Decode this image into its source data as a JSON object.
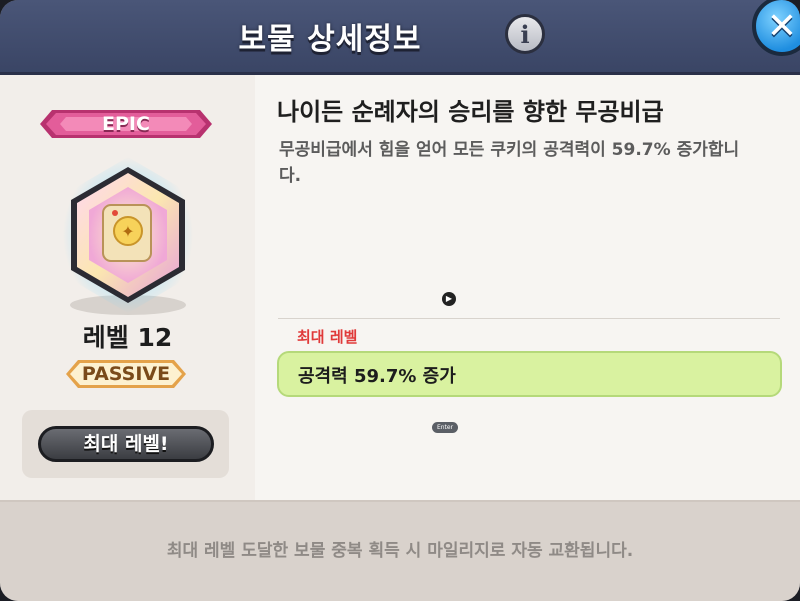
{
  "header": {
    "title": "보물 상세정보",
    "info_icon": "i",
    "close_icon": "✕"
  },
  "treasure": {
    "rarity": "EPIC",
    "level": "레벨 12",
    "type": "PASSIVE",
    "max_button": "최대 레벨!"
  },
  "detail": {
    "name": "나이든 순례자의 승리를 향한 무공비급",
    "description": "무공비급에서 힘을 얻어 모든 쿠키의 공격력이 59.7% 증가합니다.",
    "max_level_label": "최대 레벨",
    "effect": "공격력 59.7% 증가",
    "enter_badge": "Enter"
  },
  "footer": {
    "notice": "최대 레벨 도달한 보물 중복 획득 시 마일리지로 자동 교환됩니다."
  },
  "colors": {
    "header": "#3a4565",
    "epic": "#e0508f",
    "effect_bg": "#d9f2a0",
    "max_label": "#e03a3a"
  }
}
